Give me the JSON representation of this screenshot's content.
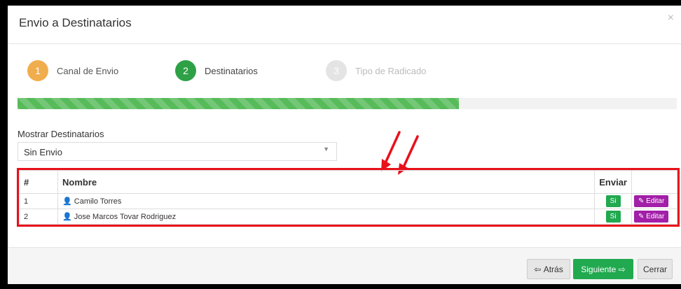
{
  "modal": {
    "title": "Envio a Destinatarios",
    "close_symbol": "×"
  },
  "steps": [
    {
      "number": "1",
      "label": "Canal de Envio",
      "color": "#f0ad4e",
      "state": "done"
    },
    {
      "number": "2",
      "label": "Destinatarios",
      "color": "#2ea146",
      "state": "active"
    },
    {
      "number": "3",
      "label": "Tipo de Radicado",
      "color": "#e4e4e4",
      "state": "pending"
    }
  ],
  "progress": {
    "fraction": 0.67,
    "color": "#57bb5a"
  },
  "filter": {
    "label": "Mostrar Destinatarios",
    "value": "Sin Envio",
    "caret": "▼"
  },
  "table": {
    "headers": [
      "#",
      "Nombre",
      "Enviar",
      ""
    ],
    "rows": [
      {
        "num": "1",
        "name": "Camilo Torres",
        "send": "Si",
        "edit": "Editar"
      },
      {
        "num": "2",
        "name": "Jose Marcos Tovar Rodriguez",
        "send": "Si",
        "edit": "Editar"
      }
    ]
  },
  "annotation": {
    "color": "#e8101b"
  },
  "footer": {
    "back": "Atrás",
    "next": "Siguiente",
    "close": "Cerrar"
  },
  "colors": {
    "green": "#21a94f",
    "purple": "#a21fa8",
    "red_highlight": "#e8101b"
  }
}
